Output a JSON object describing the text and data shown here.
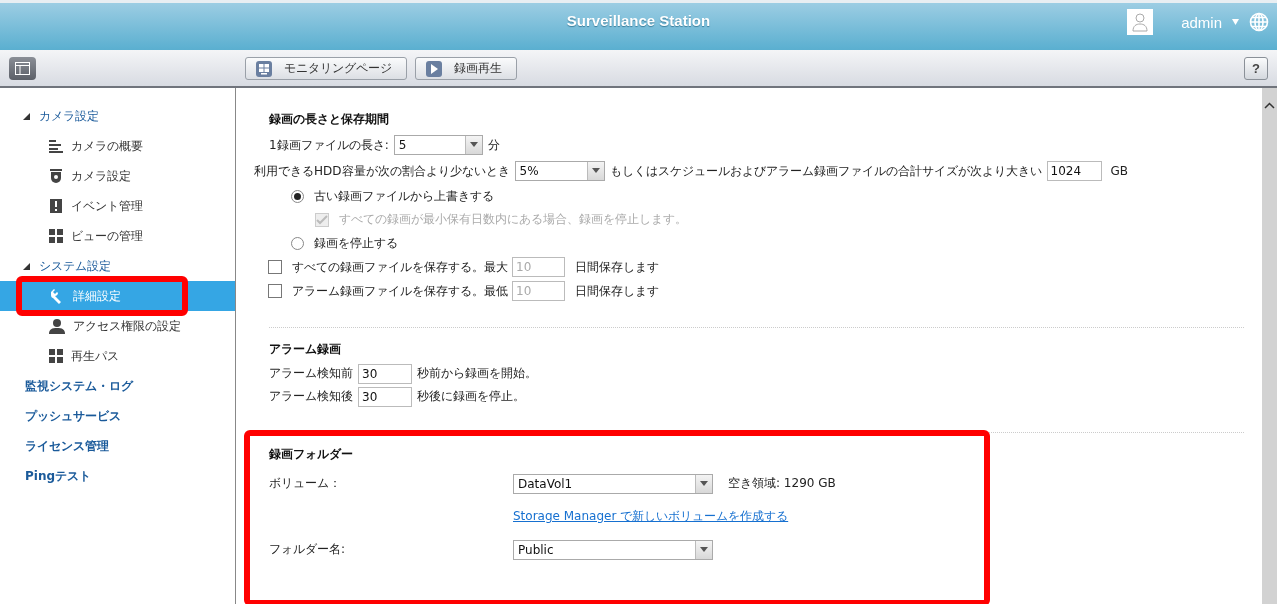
{
  "header": {
    "title": "Surveillance Station",
    "user": "admin"
  },
  "toolbar": {
    "buttons": [
      {
        "label": "モニタリングページ",
        "kind": "monitor"
      },
      {
        "label": "録画再生",
        "kind": "play"
      }
    ],
    "help": "?"
  },
  "sidebar": {
    "items": [
      {
        "kind": "group",
        "label": "カメラ設定",
        "expanded": true,
        "children": [
          {
            "label": "カメラの概要",
            "kind": "list",
            "selected": false
          },
          {
            "label": "カメラ設定",
            "kind": "camera",
            "selected": false
          },
          {
            "label": "イベント管理",
            "kind": "alert",
            "selected": false
          },
          {
            "label": "ビューの管理",
            "kind": "grid",
            "selected": false
          }
        ]
      },
      {
        "kind": "group",
        "label": "システム設定",
        "expanded": true,
        "children": [
          {
            "label": "詳細設定",
            "kind": "wrench",
            "selected": true
          },
          {
            "label": "アクセス権限の設定",
            "kind": "user",
            "selected": false
          },
          {
            "label": "再生パス",
            "kind": "grid",
            "selected": false
          }
        ]
      },
      {
        "kind": "link",
        "label": "監視システム・ログ",
        "selected": false
      },
      {
        "kind": "link",
        "label": "プッシュサービス",
        "selected": false
      },
      {
        "kind": "link",
        "label": "ライセンス管理",
        "selected": false
      },
      {
        "kind": "link",
        "label": "Pingテスト",
        "selected": false
      }
    ]
  },
  "recording_length": {
    "title": "録画の長さと保存期間",
    "file_length": {
      "label": "1録画ファイルの長さ:",
      "value": "5",
      "unit": "分"
    },
    "threshold": {
      "label": "利用できるHDD容量が次の割合より少ないとき",
      "value": "5%",
      "middle": "もしくはスケジュールおよびアラーム録画ファイルの合計サイズが次より大きい",
      "size": "1024",
      "unit": "GB"
    },
    "options": [
      {
        "label": "古い録画ファイルから上書きする",
        "selected": true,
        "sub": {
          "label": "すべての録画が最小保有日数内にある場合、録画を停止します。",
          "checked": true,
          "disabled": true
        }
      },
      {
        "label": "録画を停止する",
        "selected": false
      }
    ],
    "retention": [
      {
        "label": "すべての録画ファイルを保存する。最大",
        "value": "10",
        "unit": "日間保存します",
        "checked": false,
        "disabled": true
      },
      {
        "label": "アラーム録画ファイルを保存する。最低",
        "value": "10",
        "unit": "日間保存します",
        "checked": false,
        "disabled": true
      }
    ]
  },
  "alarm_recording": {
    "title": "アラーム録画",
    "rows": [
      {
        "label": "アラーム検知前",
        "value": "30",
        "suffix": "秒前から録画を開始。"
      },
      {
        "label": "アラーム検知後",
        "value": "30",
        "suffix": "秒後に録画を停止。"
      }
    ]
  },
  "recording_folder": {
    "title": "録画フォルダー",
    "volume": {
      "label": "ボリューム：",
      "value": "DataVol1",
      "free": "空き領域: 1290 GB"
    },
    "link": "Storage Manager で新しいボリュームを作成する",
    "folder": {
      "label": "フォルダー名:",
      "value": "Public"
    }
  }
}
